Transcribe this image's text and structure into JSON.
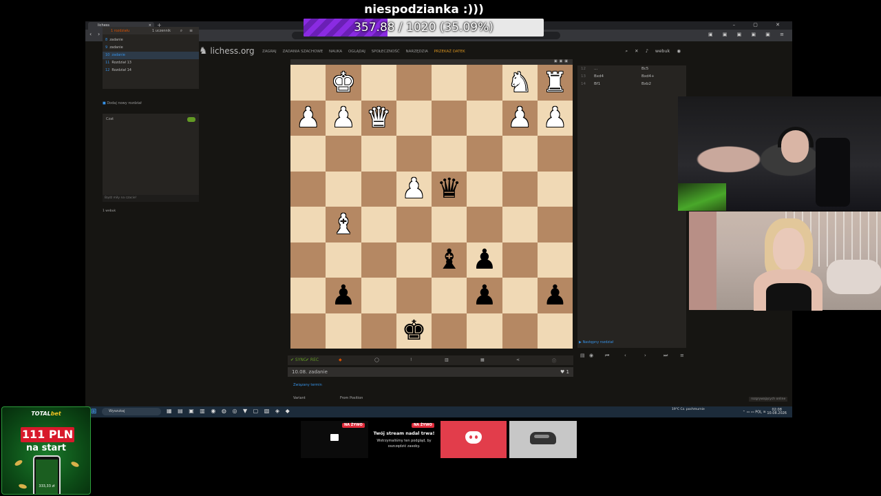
{
  "overlay": {
    "goal_title": "niespodzianka :)))",
    "goal_text": "357.88 / 1020 (35.09%)",
    "goal_fraction": 0.3509
  },
  "browser": {
    "tab_title": "lichess",
    "controls": "– ▢ ✕"
  },
  "lichess": {
    "logo": "lichess.org",
    "nav": [
      "ZAGRAJ",
      "ZADANIA SZACHOWE",
      "NAUKA",
      "OGLĄDAJ",
      "SPOŁECZNOŚĆ",
      "NARZĘDZIA"
    ],
    "nav_accent": "PRZEKAŻ DATEK",
    "username": "webuk",
    "study_tabs": [
      "1 rozdziału",
      "1 uczennik"
    ],
    "chapters": [
      {
        "num": "8",
        "label": "zadanie"
      },
      {
        "num": "9",
        "label": "zadanie"
      },
      {
        "num": "10",
        "label": "zadanie"
      },
      {
        "num": "11",
        "label": "Rozdział 13"
      },
      {
        "num": "12",
        "label": "Rozdział 14"
      }
    ],
    "add_chapter": "Dodaj nowy rozdział",
    "chat_title": "Czat",
    "chat_placeholder": "Bądź miły na czacie!",
    "members": "1 webuk",
    "chapter_title": "10.08. zadanie",
    "likes": "1",
    "chapter_link": "Związany termin",
    "variant_label": "Variant",
    "variant_value": "From Position",
    "next_chapter": "Następny rozdział",
    "spectators": "rozgrywających online",
    "toolbar": {
      "sync": "✔ SYNC",
      "rec": "✔ REC"
    },
    "moves": [
      {
        "idx": "12",
        "w": "...",
        "b": "Bc5"
      },
      {
        "idx": "13",
        "w": "Bxd4",
        "b": "Bxd4+"
      },
      {
        "idx": "14",
        "w": "Bf1",
        "b": "Bxb2"
      }
    ]
  },
  "board": {
    "rows": [
      [
        "",
        "wK",
        "",
        "",
        "",
        "",
        "wN",
        "wR"
      ],
      [
        "wP",
        "wP",
        "wQ",
        "",
        "",
        "",
        "wP",
        "wP"
      ],
      [
        "",
        "",
        "",
        "",
        "",
        "",
        "",
        ""
      ],
      [
        "",
        "",
        "",
        "wP",
        "bQ",
        "",
        "",
        ""
      ],
      [
        "",
        "wB",
        "",
        "",
        "",
        "",
        "",
        ""
      ],
      [
        "",
        "",
        "",
        "",
        "bB",
        "bP",
        "",
        ""
      ],
      [
        "",
        "bP",
        "",
        "",
        "",
        "bP",
        "",
        "bP"
      ],
      [
        "",
        "",
        "",
        "bK",
        "",
        "",
        "",
        ""
      ]
    ]
  },
  "taskbar": {
    "search": "Wyszukaj",
    "weather": "19°C Cz. pochmurnie",
    "lang": "POL",
    "time": "02:08",
    "date": "10.08.2026"
  },
  "widgets": {
    "live_badge": "NA ŻYWO",
    "stream_title": "Twój stream nadal trwa!",
    "stream_text": "Wstrzymaliśmy ten podgląd, by oszczędzić zasoby."
  },
  "ad": {
    "brand_a": "TOTAL",
    "brand_b": "bet",
    "amount": "111 PLN",
    "sub": "na start",
    "phone_amount": "333,33 zł"
  }
}
